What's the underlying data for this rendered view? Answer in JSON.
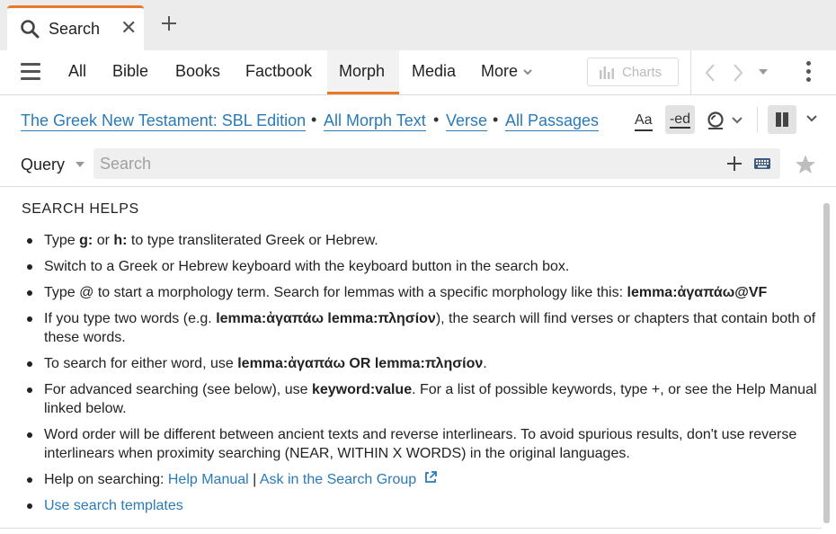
{
  "tab": {
    "label": "Search"
  },
  "nav": {
    "items": [
      "All",
      "Bible",
      "Books",
      "Factbook",
      "Morph",
      "Media",
      "More"
    ],
    "active": "Morph",
    "charts_label": "Charts"
  },
  "crumbs": {
    "resource": "The Greek New Testament: SBL Edition",
    "scope": "All Morph Text",
    "unit": "Verse",
    "range": "All Passages",
    "aa": "Aa",
    "ed": "-ed"
  },
  "query": {
    "label": "Query",
    "placeholder": "Search"
  },
  "helps": {
    "title": "SEARCH HELPS",
    "items": {
      "i0": {
        "a": "Type ",
        "b1": "g:",
        "c": " or ",
        "b2": "h:",
        "d": " to type transliterated Greek or Hebrew."
      },
      "i1": {
        "a": "Switch to a Greek or Hebrew keyboard with the keyboard button in the search box."
      },
      "i2": {
        "a": "Type @ to start a morphology term. Search for lemmas with a specific morphology like this: ",
        "b": "lemma:ἀγαπάω@VF"
      },
      "i3": {
        "a": "If you type two words (e.g. ",
        "b": "lemma:ἀγαπάω lemma:πλησίον",
        "c": "), the search will find verses or chapters that contain both of these words."
      },
      "i4": {
        "a": "To search for either word, use ",
        "b": "lemma:ἀγαπάω OR lemma:πλησίον",
        "c": "."
      },
      "i5": {
        "a": "For advanced searching (see below), use ",
        "b": "keyword:value",
        "c": ". For a list of possible keywords, type +, or see the Help Manual linked below."
      },
      "i6": {
        "a": "Word order will be different between ancient texts and reverse interlinears. To avoid spurious results, don't use reverse interlinears when proximity searching (NEAR, WITHIN X WORDS) in the original languages."
      },
      "i7": {
        "a": "Help on searching: ",
        "link1": "Help Manual",
        "sep": " | ",
        "link2": "Ask in the Search Group"
      },
      "i8": {
        "link": "Use search templates"
      }
    }
  },
  "colors": {
    "accent": "#e8782a",
    "link": "#2a7ab8"
  }
}
